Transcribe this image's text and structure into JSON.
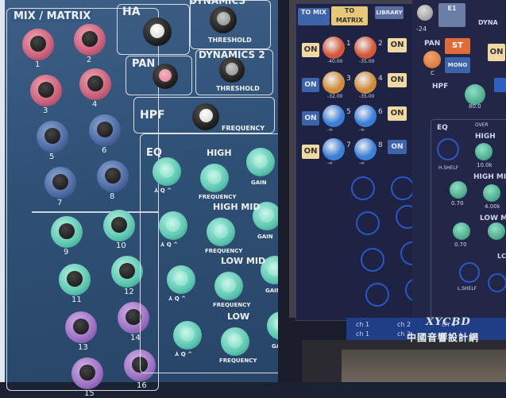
{
  "console": {
    "sections": {
      "mix_matrix": "MIX / MATRIX",
      "ha": "HA",
      "dynamics1": "DYNAMICS",
      "dynamics2": "DYNAMICS 2",
      "pan": "PAN",
      "hpf": "HPF",
      "eq": "EQ",
      "threshold": "THRESHOLD",
      "frequency": "FREQUENCY"
    },
    "mix_numbers": [
      "1",
      "2",
      "3",
      "4",
      "5",
      "6",
      "7",
      "8",
      "9",
      "10",
      "11",
      "12",
      "13",
      "14",
      "15",
      "16"
    ],
    "eq_bands": [
      {
        "name": "HIGH",
        "freq": "FREQUENCY",
        "gain": "GAIN",
        "q": "⅄ Q ^"
      },
      {
        "name": "HIGH MID",
        "freq": "FREQUENCY",
        "gain": "GAIN",
        "q": "⅄ Q ^"
      },
      {
        "name": "LOW MID",
        "freq": "FREQUENCY",
        "gain": "GAIN",
        "q": "⅄ Q ^"
      },
      {
        "name": "LOW",
        "freq": "FREQUENCY",
        "gain": "GAIN",
        "q": "⅄ Q ^"
      }
    ]
  },
  "screen": {
    "tabs": {
      "to_mix": "TO MIX",
      "to_matrix": "TO MATRIX",
      "library": "LIBRARY"
    },
    "on": "ON",
    "sends": {
      "n1": "1",
      "n2": "2",
      "n3": "3",
      "n4": "4",
      "n5": "5",
      "n6": "6",
      "n7": "7",
      "n8": "8",
      "v1": "-40.00",
      "v2": "-35.00",
      "v3": "-32.00",
      "v4": "-35.00",
      "inf": "-∞"
    },
    "right": {
      "pan": "PAN",
      "dyna": "DYNA",
      "hpf": "HPF",
      "eq": "EQ",
      "over": "OVER",
      "high": "HIGH",
      "high_mid": "HIGH MID",
      "low_mid": "LOW M",
      "st": "ST",
      "mono": "MONO",
      "e1": "E1",
      "minus24": "-24",
      "v80": "80.0",
      "v10k": "10.0k",
      "v070": "0.70",
      "v4k": "4.00k",
      "v070b": "0.70",
      "h_shelf": "H.SHELF",
      "l_shelf": "L.SHELF",
      "c": "C",
      "lc": "LC"
    },
    "channels": {
      "ch1": "ch 1",
      "ch2": "ch 2",
      "ch3": "ch 3",
      "ch4": "ch 4"
    }
  },
  "watermark": {
    "brand": "XYCBD",
    "text": "中國音響設計網"
  },
  "colors": {
    "panel": "#2f5075",
    "screen": "#1b1c2c",
    "on_button": "#f1d9a4",
    "accent_blue": "#3d63a8"
  }
}
